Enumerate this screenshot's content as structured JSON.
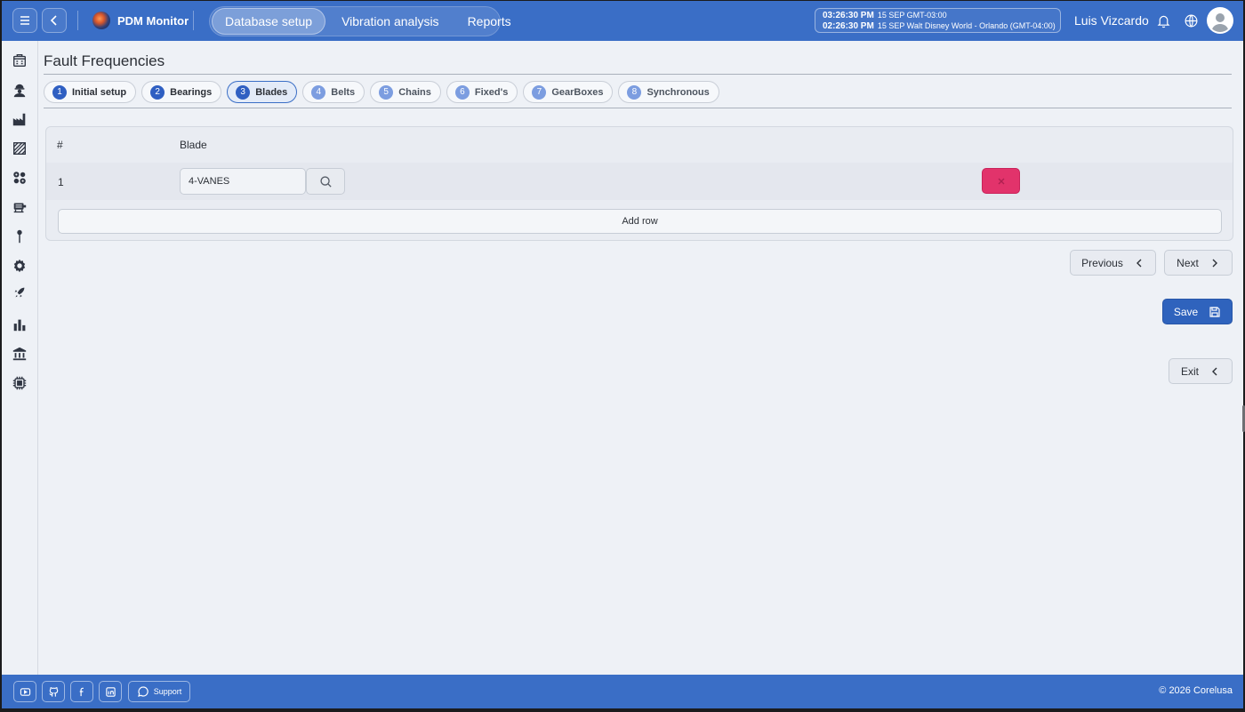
{
  "topbar": {
    "brand": "PDM Monitor",
    "nav": [
      "Database setup",
      "Vibration analysis",
      "Reports"
    ],
    "clock": [
      {
        "time": "03:26:30 PM",
        "detail": "15 SEP  GMT-03:00"
      },
      {
        "time": "02:26:30 PM",
        "detail": "15 SEP  Walt Disney World - Orlando (GMT-04:00)"
      }
    ],
    "user": "Luis Vizcardo"
  },
  "page": {
    "title": "Fault Frequencies",
    "steps": [
      {
        "num": "1",
        "label": "Initial setup"
      },
      {
        "num": "2",
        "label": "Bearings"
      },
      {
        "num": "3",
        "label": "Blades"
      },
      {
        "num": "4",
        "label": "Belts"
      },
      {
        "num": "5",
        "label": "Chains"
      },
      {
        "num": "6",
        "label": "Fixed's"
      },
      {
        "num": "7",
        "label": "GearBoxes"
      },
      {
        "num": "8",
        "label": "Synchronous"
      }
    ],
    "active_step": 3
  },
  "table": {
    "headers": {
      "num": "#",
      "blade": "Blade"
    },
    "rows": [
      {
        "num": "1",
        "blade": "4-VANES"
      }
    ],
    "add_row_label": "Add row"
  },
  "actions": {
    "previous": "Previous",
    "next": "Next",
    "save": "Save",
    "exit": "Exit"
  },
  "footer": {
    "support": "Support",
    "copyright": "© 2026 Corelusa"
  },
  "colors": {
    "primary": "#3a6ec6",
    "danger": "#e2336b",
    "background": "#eef1f6"
  }
}
